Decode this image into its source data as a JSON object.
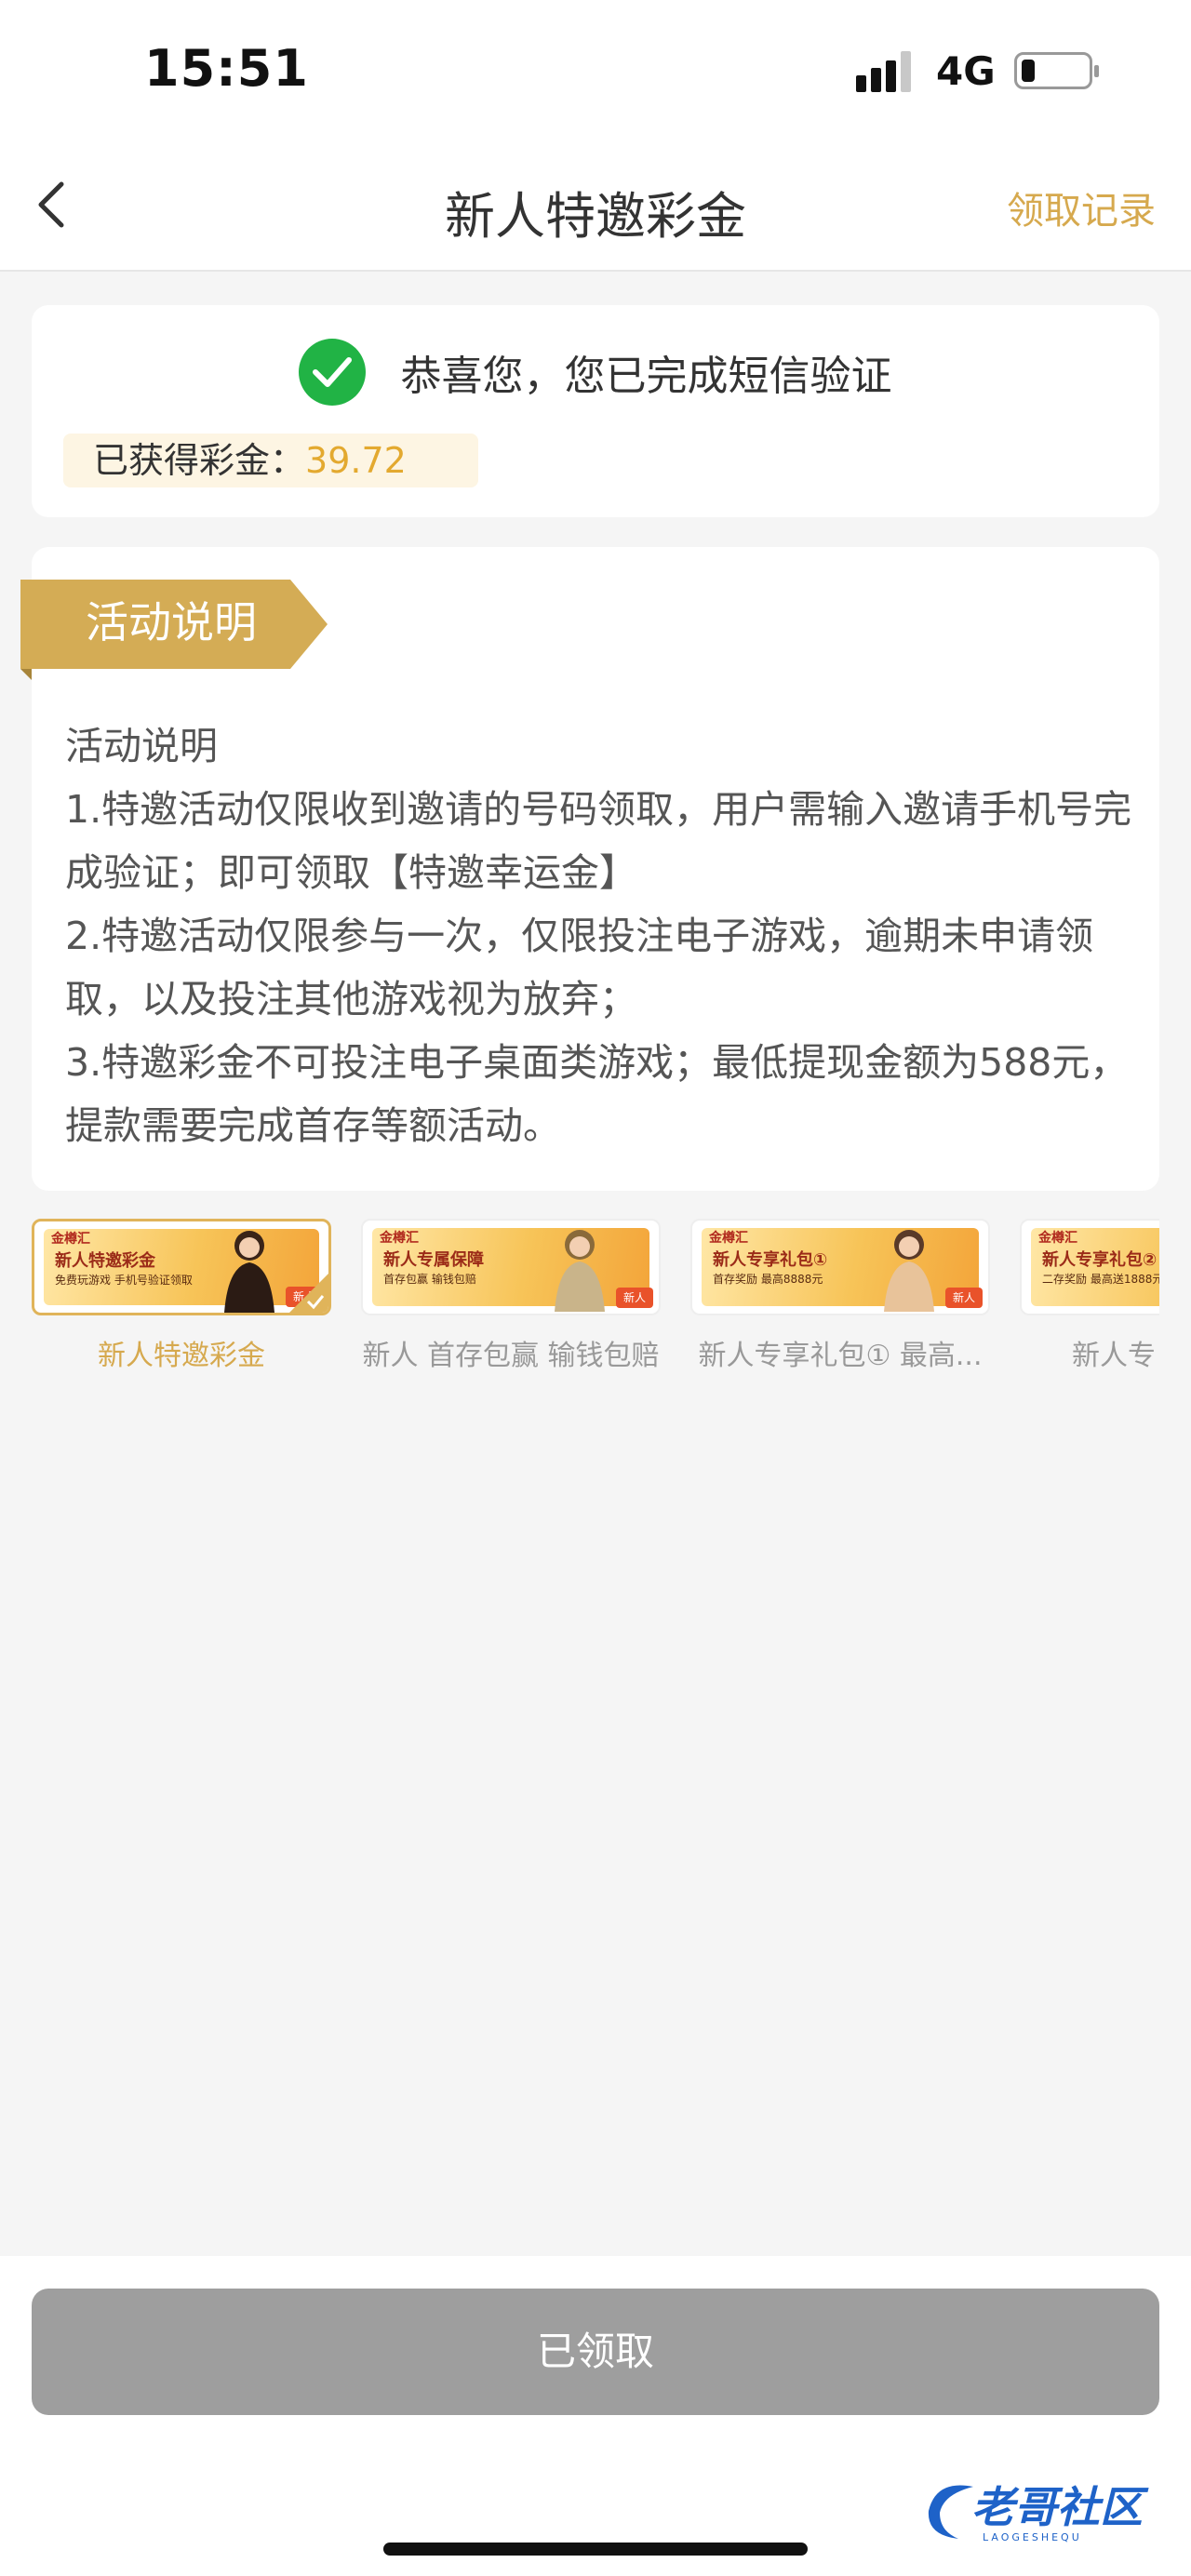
{
  "status_bar": {
    "time": "15:51",
    "network": "4G"
  },
  "nav": {
    "title": "新人特邀彩金",
    "right_link": "领取记录"
  },
  "success_card": {
    "message": "恭喜您，您已完成短信验证",
    "bonus_label": "已获得彩金：",
    "bonus_value": "39.72"
  },
  "description": {
    "tag": "活动说明",
    "lines": [
      "活动说明",
      "1.特邀活动仅限收到邀请的号码领取，用户需输入邀请手机号完成验证；即可领取【特邀幸运金】",
      "2.特邀活动仅限参与一次，仅限投注电子游戏，逾期未申请领取，以及投注其他游戏视为放弃；",
      "3.特邀彩金不可投注电子桌面类游戏；最低提现金额为588元，提款需要完成首存等额活动。"
    ]
  },
  "promotions": [
    {
      "caption": "新人特邀彩金",
      "banner_logo": "金樽汇",
      "banner_title": "新人特邀彩金",
      "banner_sub": "免费玩游戏 手机号验证领取",
      "badge": "新人",
      "selected": true
    },
    {
      "caption": "新人 首存包赢 输钱包赔",
      "banner_logo": "金樽汇",
      "banner_title": "新人专属保障",
      "banner_sub": "首存包赢 输钱包赔",
      "badge": "新人",
      "selected": false
    },
    {
      "caption": "新人专享礼包① 最高...",
      "banner_logo": "金樽汇",
      "banner_title": "新人专享礼包①",
      "banner_sub": "首存奖励 最高8888元",
      "badge": "新人",
      "selected": false
    },
    {
      "caption": "新人专",
      "banner_logo": "金樽汇",
      "banner_title": "新人专享礼包②",
      "banner_sub": "二存奖励 最高送1888元",
      "badge": "新人",
      "selected": false
    }
  ],
  "bottom": {
    "button_label": "已领取"
  },
  "watermark": {
    "text": "老哥社区",
    "sub": "LAOGESHEQU"
  },
  "colors": {
    "accent_gold": "#d6a94e",
    "success_green": "#21b345",
    "button_disabled": "#9e9e9e",
    "bonus_value": "#e3a92f"
  }
}
